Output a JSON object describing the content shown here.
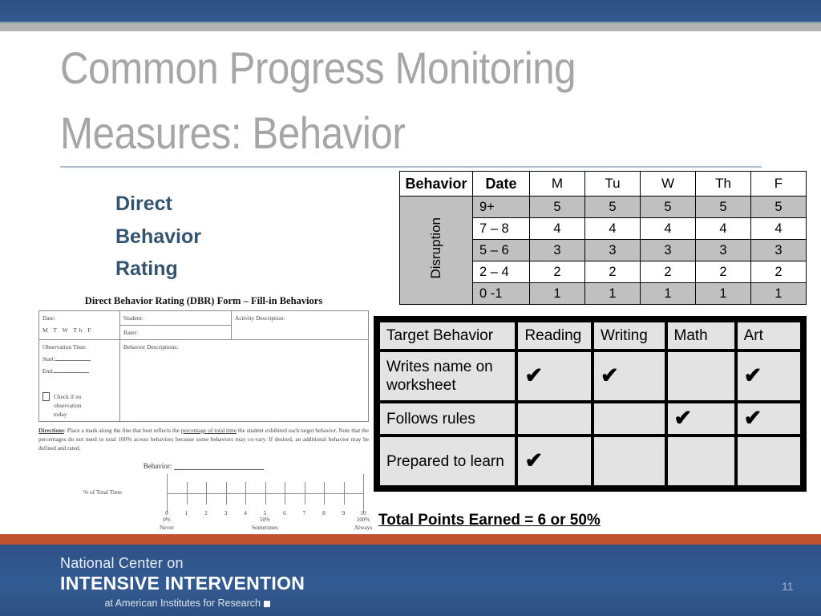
{
  "slide": {
    "title_line1": "Common Progress Monitoring",
    "title_line2": "Measures: Behavior",
    "number": "11",
    "accent_blue": "#33536e",
    "band_blue": "#31548a",
    "band_orange": "#c0522e",
    "title_gray": "#a6a6a6"
  },
  "section_heading": {
    "line1": "Direct",
    "line2": "Behavior",
    "line3": "Rating"
  },
  "disruption_table": {
    "headers": [
      "Behavior",
      "Date",
      "M",
      "Tu",
      "W",
      "Th",
      "F"
    ],
    "behavior_label": "Disruption",
    "rows": [
      {
        "date": "9+",
        "values": [
          "5",
          "5",
          "5",
          "5",
          "5"
        ],
        "shaded": true
      },
      {
        "date": "7 – 8",
        "values": [
          "4",
          "4",
          "4",
          "4",
          "4"
        ],
        "shaded": false
      },
      {
        "date": "5 – 6",
        "values": [
          "3",
          "3",
          "3",
          "3",
          "3"
        ],
        "shaded": true
      },
      {
        "date": "2 – 4",
        "values": [
          "2",
          "2",
          "2",
          "2",
          "2"
        ],
        "shaded": false
      },
      {
        "date": "0 -1",
        "values": [
          "1",
          "1",
          "1",
          "1",
          "1"
        ],
        "shaded": true
      }
    ]
  },
  "target_behavior_table": {
    "headers": [
      "Target Behavior",
      "Reading",
      "Writing",
      "Math",
      "Art"
    ],
    "check_glyph": "✔",
    "rows": [
      {
        "behavior": "Writes name on worksheet",
        "checks": [
          true,
          true,
          false,
          true
        ]
      },
      {
        "behavior": "Follows rules",
        "checks": [
          false,
          false,
          true,
          true
        ]
      },
      {
        "behavior": "Prepared to learn",
        "checks": [
          true,
          false,
          false,
          false
        ]
      }
    ],
    "total_line": "Total Points Earned = 6 or 50%"
  },
  "dbr_form": {
    "title": "Direct Behavior Rating (DBR) Form – Fill-in Behaviors",
    "date_label": "Date:",
    "days": "M   T   W   Th   F",
    "student_label": "Student:",
    "rater_label": "Rater:",
    "activity_label": "Activity Description:",
    "observation_label": "Observation Time:",
    "start_label": "Start:",
    "end_label": "End:",
    "checkbox_text_1": "Check if no",
    "checkbox_text_2": "observation",
    "checkbox_text_3": "today",
    "behavior_descriptions_label": "Behavior Descriptions:",
    "directions_bold": "Directions",
    "directions_a": ":  Place a mark along the line that best reflects the ",
    "directions_underlined": "percentage of total time",
    "directions_b": " the student exhibited each target behavior.  Note that the percentages do not need to total 100% across behaviors because some behaviors may co-vary.  If desired, an additional behavior may be defined and rated.",
    "behavior_blank_label": "Behavior:",
    "scale_axis_label": "% of Total Time",
    "scale_ticks": [
      "0",
      "1",
      "2",
      "3",
      "4",
      "5",
      "6",
      "7",
      "8",
      "9",
      "10"
    ],
    "scale_percents": {
      "left": "0%",
      "middle": "50%",
      "right": "100%"
    },
    "scale_words": {
      "left": "Never",
      "middle": "Sometimes",
      "right": "Always"
    }
  },
  "footer": {
    "org_line1": "National Center on",
    "org_line2": "INTENSIVE INTERVENTION",
    "org_line3": "at American Institutes for Research"
  }
}
